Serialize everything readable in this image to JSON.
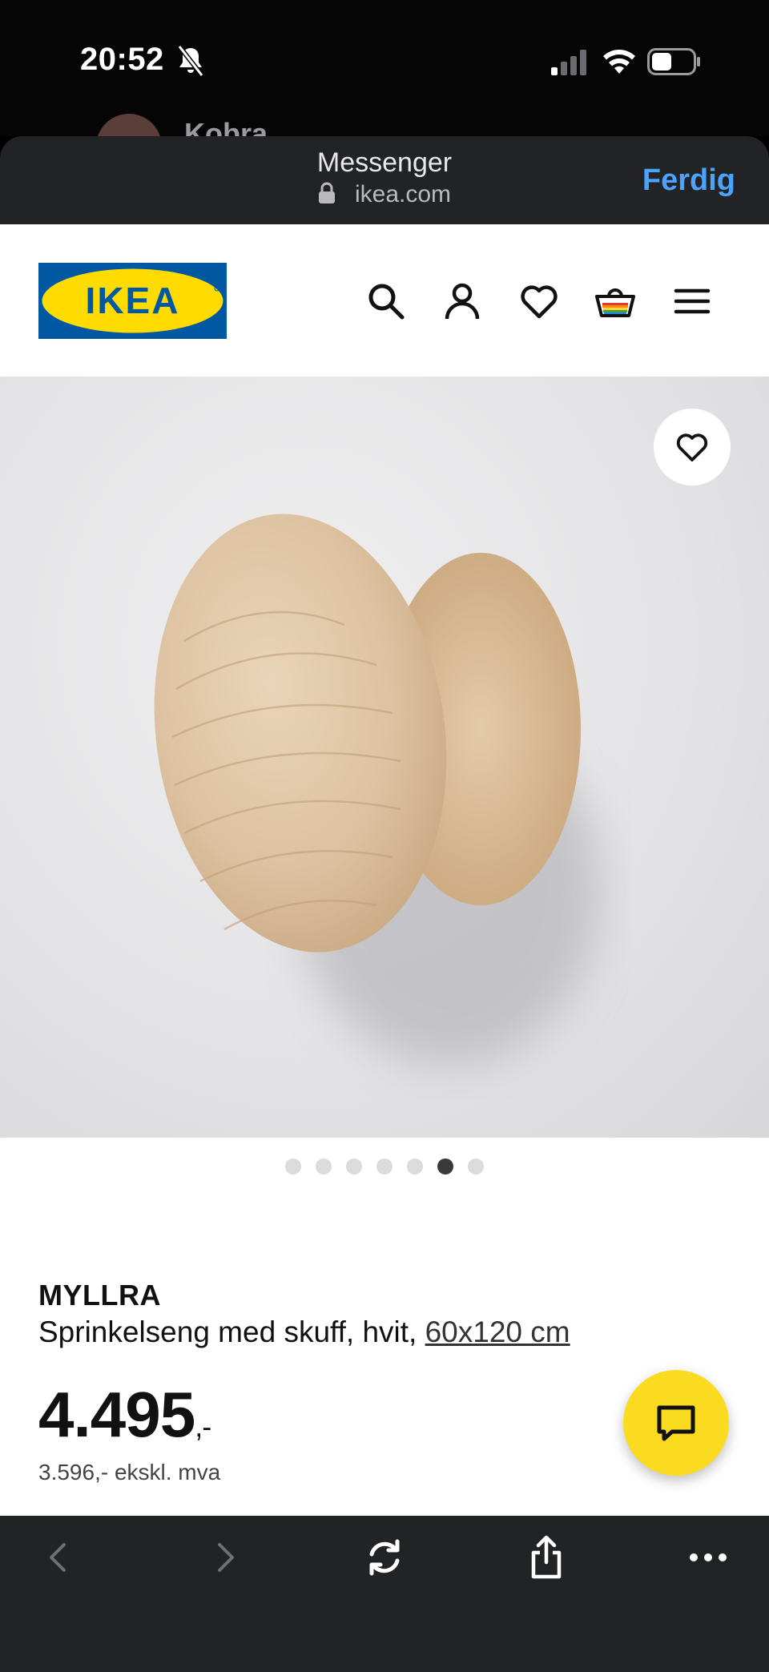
{
  "status_bar": {
    "time": "20:52",
    "icons": [
      "bell-slash-icon",
      "cellular-signal-icon",
      "wifi-icon",
      "battery-icon"
    ]
  },
  "behind_app": {
    "contact_name": "Kobra"
  },
  "browser": {
    "title": "Messenger",
    "url": "ikea.com",
    "done_label": "Ferdig",
    "accent_color": "#4aa3ff"
  },
  "nav": {
    "logo_text": "IKEA",
    "icons": [
      "search-icon",
      "account-icon",
      "wishlist-heart-icon",
      "shopping-bag-icon",
      "menu-hamburger-icon"
    ],
    "brand_colors": {
      "blue": "#0058a3",
      "yellow": "#ffdb00"
    }
  },
  "gallery": {
    "dot_count": 7,
    "active_index": 5
  },
  "product": {
    "name": "MYLLRA",
    "description": "Sprinkelseng med skuff, hvit,",
    "size_link": "60x120 cm",
    "price_main": "4.495",
    "price_suffix": ",-",
    "price_ex_vat": "3.596,- ekskl. mva"
  },
  "toolbar": {
    "icons": [
      "back-icon",
      "forward-icon",
      "reload-icon",
      "share-icon",
      "more-icon"
    ]
  }
}
